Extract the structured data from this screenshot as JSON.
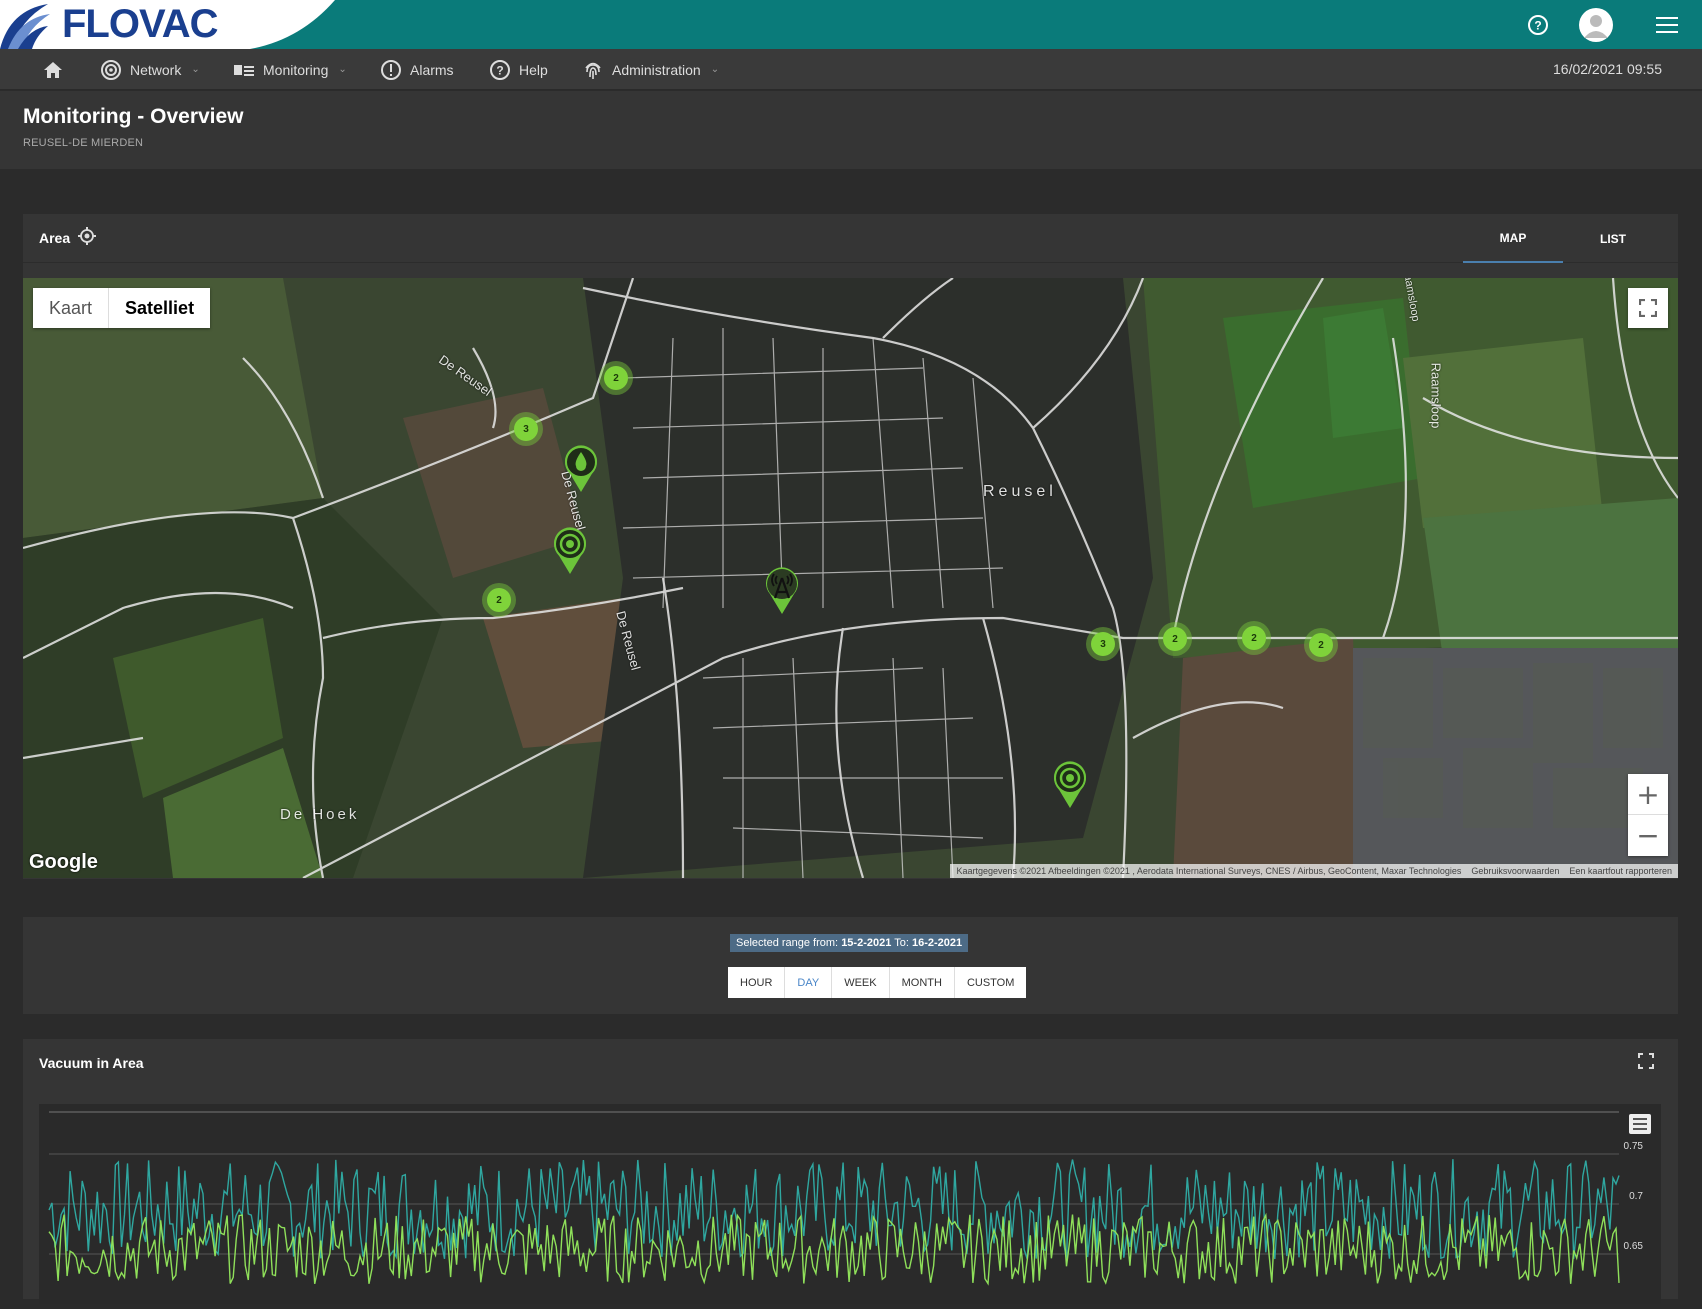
{
  "app": {
    "logo": "FLOVAC"
  },
  "nav": {
    "items": [
      {
        "label": "Network",
        "icon": "network-icon",
        "dropdown": true
      },
      {
        "label": "Monitoring",
        "icon": "monitoring-icon",
        "dropdown": true
      },
      {
        "label": "Alarms",
        "icon": "alarm-icon",
        "dropdown": false
      },
      {
        "label": "Help",
        "icon": "help-icon",
        "dropdown": false
      },
      {
        "label": "Administration",
        "icon": "fingerprint-icon",
        "dropdown": true
      }
    ],
    "datetime": "16/02/2021 09:55"
  },
  "header": {
    "title": "Monitoring - Overview",
    "subtitle": "REUSEL-DE MIERDEN"
  },
  "area": {
    "title": "Area",
    "tabs": {
      "map": "MAP",
      "list": "LIST"
    },
    "map": {
      "type_kaart": "Kaart",
      "type_satelliet": "Satelliet",
      "google": "Google",
      "attribution": "Kaartgegevens ©2021 Afbeeldingen ©2021 , Aerodata International Surveys, CNES / Airbus, GeoContent, Maxar Technologies",
      "terms": "Gebruiksvoorwaarden",
      "report": "Een kaartfout rapporteren",
      "places": [
        "De Reusel",
        "De Reusel",
        "De Reusel",
        "Reusel",
        "De Hoek",
        "Raamsloop",
        "Raamsloop"
      ],
      "clusters": [
        "2",
        "3",
        "2",
        "3",
        "2",
        "2",
        "2"
      ]
    }
  },
  "range": {
    "label_prefix": "Selected range from:",
    "from": "15-2-2021",
    "label_to": "To:",
    "to": "16-2-2021",
    "buttons": [
      "HOUR",
      "DAY",
      "WEEK",
      "MONTH",
      "CUSTOM"
    ],
    "selected": "DAY"
  },
  "vacuum": {
    "title": "Vacuum in Area"
  },
  "chart_data": {
    "type": "line",
    "title": "",
    "yticks": [
      "0.75",
      "0.7",
      "0.65"
    ],
    "ylim": [
      0.6,
      0.77
    ],
    "series": [
      {
        "color": "#2fa7a0"
      },
      {
        "color": "#8fe05a"
      }
    ]
  },
  "colors": {
    "topbar": "#0a7b7a",
    "accent": "#4a7fae",
    "cluster": "#7fd33a"
  }
}
